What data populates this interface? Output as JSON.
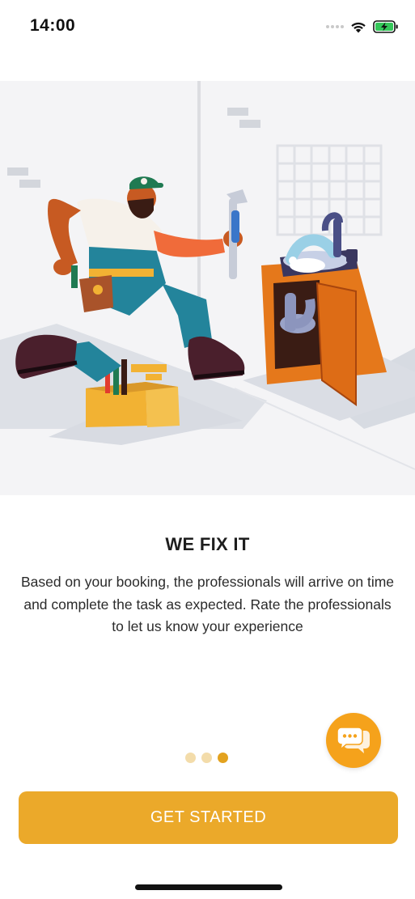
{
  "status_bar": {
    "time": "14:00",
    "icons": [
      "signal-dots-icon",
      "wifi-icon",
      "battery-charging-icon"
    ]
  },
  "hero": {
    "illustration": "plumber-fixing-sink-illustration"
  },
  "onboarding": {
    "title": "WE FIX IT",
    "description": "Based on your booking, the professionals will arrive on time and complete the task as expected. Rate the professionals to let us know your experience",
    "page_indicator": {
      "total": 3,
      "active_index": 2
    }
  },
  "chat_button": {
    "icon": "chat-bubbles-icon"
  },
  "cta": {
    "label": "GET STARTED"
  },
  "colors": {
    "accent": "#eba92a",
    "chat_fab": "#f5a21b",
    "dot_active": "#e3a21f",
    "dot_inactive": "#f3dcaa",
    "hero_background": "#f4f4f6",
    "sink_orange": "#e5781b",
    "toolbox_yellow": "#f2b233",
    "overalls_teal": "#23849b"
  }
}
